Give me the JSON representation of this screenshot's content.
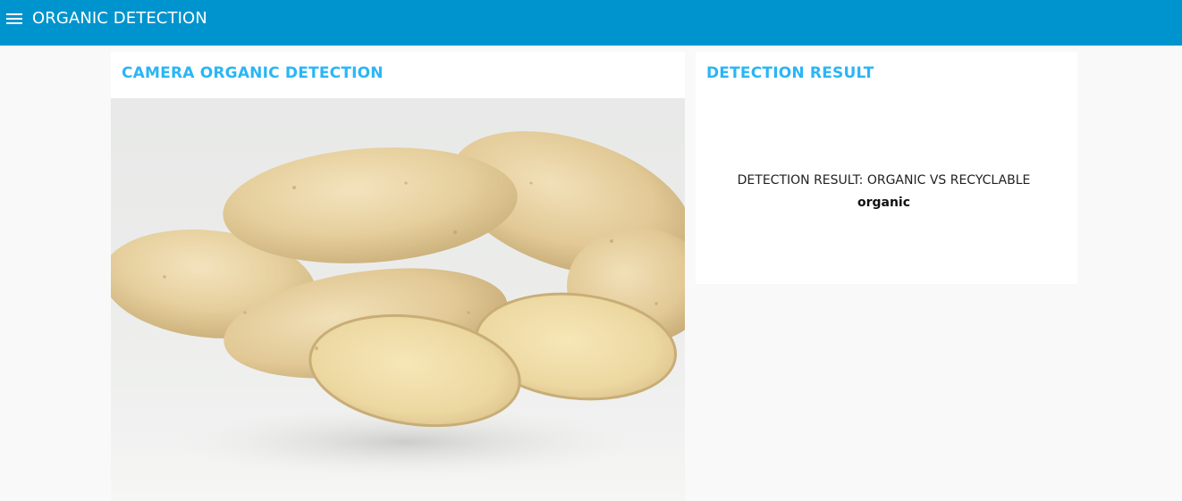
{
  "header": {
    "title": "ORGANIC DETECTION",
    "menu_icon": "hamburger-menu-icon",
    "background_color": "#0094ce"
  },
  "camera_card": {
    "title": "CAMERA ORGANIC DETECTION",
    "image_subject": "potatoes",
    "title_color": "#29b6f6"
  },
  "result_card": {
    "title": "DETECTION RESULT",
    "label": "DETECTION RESULT: ORGANIC VS RECYCLABLE",
    "value": "organic",
    "title_color": "#29b6f6"
  }
}
